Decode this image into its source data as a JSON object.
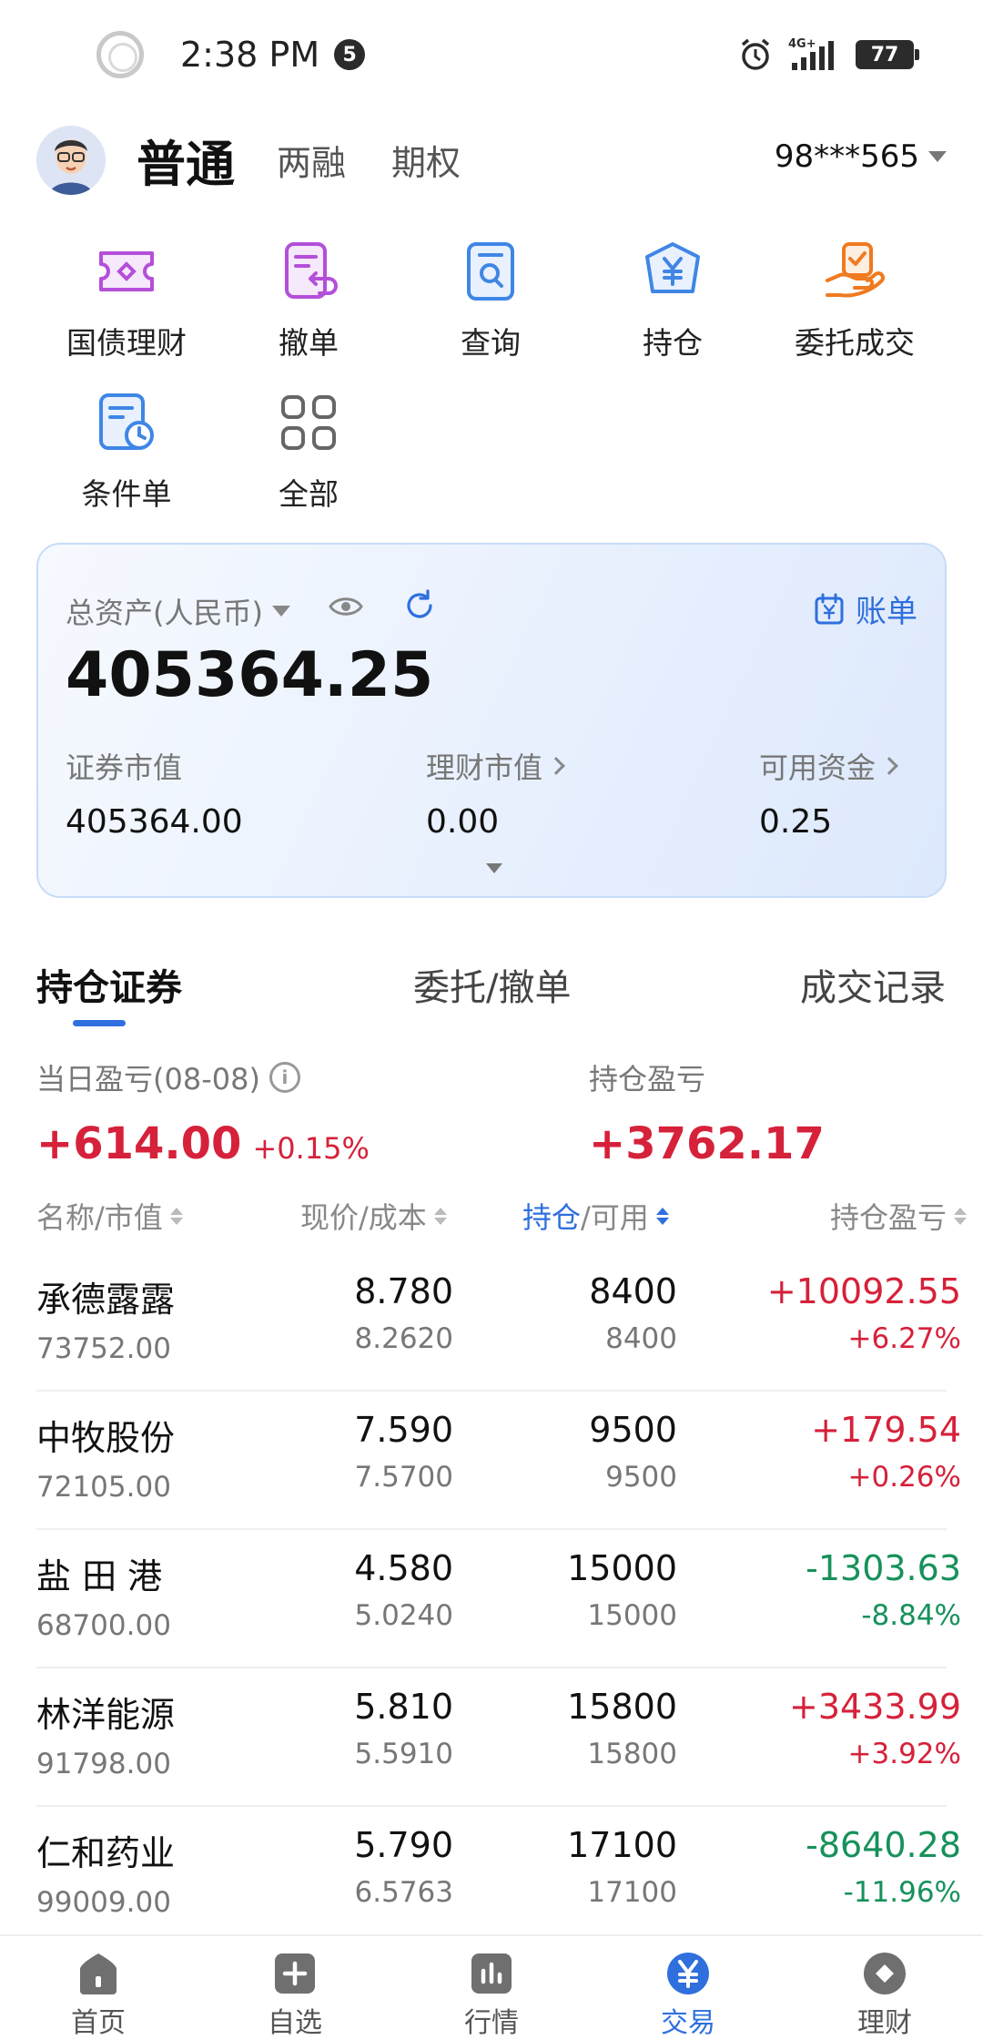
{
  "status_bar": {
    "time": "2:38 PM",
    "notification_count": "5",
    "network": "4G+",
    "battery": "77"
  },
  "account": {
    "tabs": [
      "普通",
      "两融",
      "期权"
    ],
    "active_tab": "普通",
    "account_number": "98***565"
  },
  "quick_actions": [
    {
      "label": "国债理财",
      "icon": "ticket-icon"
    },
    {
      "label": "撤单",
      "icon": "cancel-order-icon"
    },
    {
      "label": "查询",
      "icon": "query-icon"
    },
    {
      "label": "持仓",
      "icon": "yen-shield-icon"
    },
    {
      "label": "委托成交",
      "icon": "hand-check-icon"
    },
    {
      "label": "条件单",
      "icon": "condition-order-icon"
    },
    {
      "label": "全部",
      "icon": "grid-icon"
    }
  ],
  "assets": {
    "total_label": "总资产(人民币)",
    "total_value": "405364.25",
    "bill_label": "账单",
    "securities_label": "证券市值",
    "securities_value": "405364.00",
    "wealth_label": "理财市值",
    "wealth_value": "0.00",
    "cash_label": "可用资金",
    "cash_value": "0.25"
  },
  "section_tabs": [
    "持仓证券",
    "委托/撤单",
    "成交记录"
  ],
  "pnl": {
    "daily_label": "当日盈亏(08-08)",
    "daily_value": "+614.00",
    "daily_pct": "+0.15%",
    "position_label": "持仓盈亏",
    "position_value": "+3762.17"
  },
  "table_header": {
    "name": "名称/市值",
    "price": "现价/成本",
    "qty_a": "持仓",
    "qty_b": "/可用",
    "pnl": "持仓盈亏"
  },
  "holdings": [
    {
      "name": "承德露露",
      "market_value": "73752.00",
      "price": "8.780",
      "cost": "8.2620",
      "qty": "8400",
      "available": "8400",
      "pnl": "+10092.55",
      "pnl_pct": "+6.27%"
    },
    {
      "name": "中牧股份",
      "market_value": "72105.00",
      "price": "7.590",
      "cost": "7.5700",
      "qty": "9500",
      "available": "9500",
      "pnl": "+179.54",
      "pnl_pct": "+0.26%"
    },
    {
      "name": "盐 田 港",
      "market_value": "68700.00",
      "price": "4.580",
      "cost": "5.0240",
      "qty": "15000",
      "available": "15000",
      "pnl": "-1303.63",
      "pnl_pct": "-8.84%"
    },
    {
      "name": "林洋能源",
      "market_value": "91798.00",
      "price": "5.810",
      "cost": "5.5910",
      "qty": "15800",
      "available": "15800",
      "pnl": "+3433.99",
      "pnl_pct": "+3.92%"
    },
    {
      "name": "仁和药业",
      "market_value": "99009.00",
      "price": "5.790",
      "cost": "6.5763",
      "qty": "17100",
      "available": "17100",
      "pnl": "-8640.28",
      "pnl_pct": "-11.96%"
    }
  ],
  "bottom_nav": [
    {
      "label": "首页",
      "icon": "home-icon"
    },
    {
      "label": "自选",
      "icon": "plus-square-icon"
    },
    {
      "label": "行情",
      "icon": "bar-chart-icon"
    },
    {
      "label": "交易",
      "icon": "yen-circle-icon"
    },
    {
      "label": "理财",
      "icon": "diamond-icon"
    }
  ],
  "colors": {
    "accent": "#2f6fde",
    "up": "#d6213a",
    "down": "#17915b",
    "quick_purple": "#b44fd9",
    "quick_blue": "#3f86e6",
    "quick_orange": "#f07a1f"
  }
}
